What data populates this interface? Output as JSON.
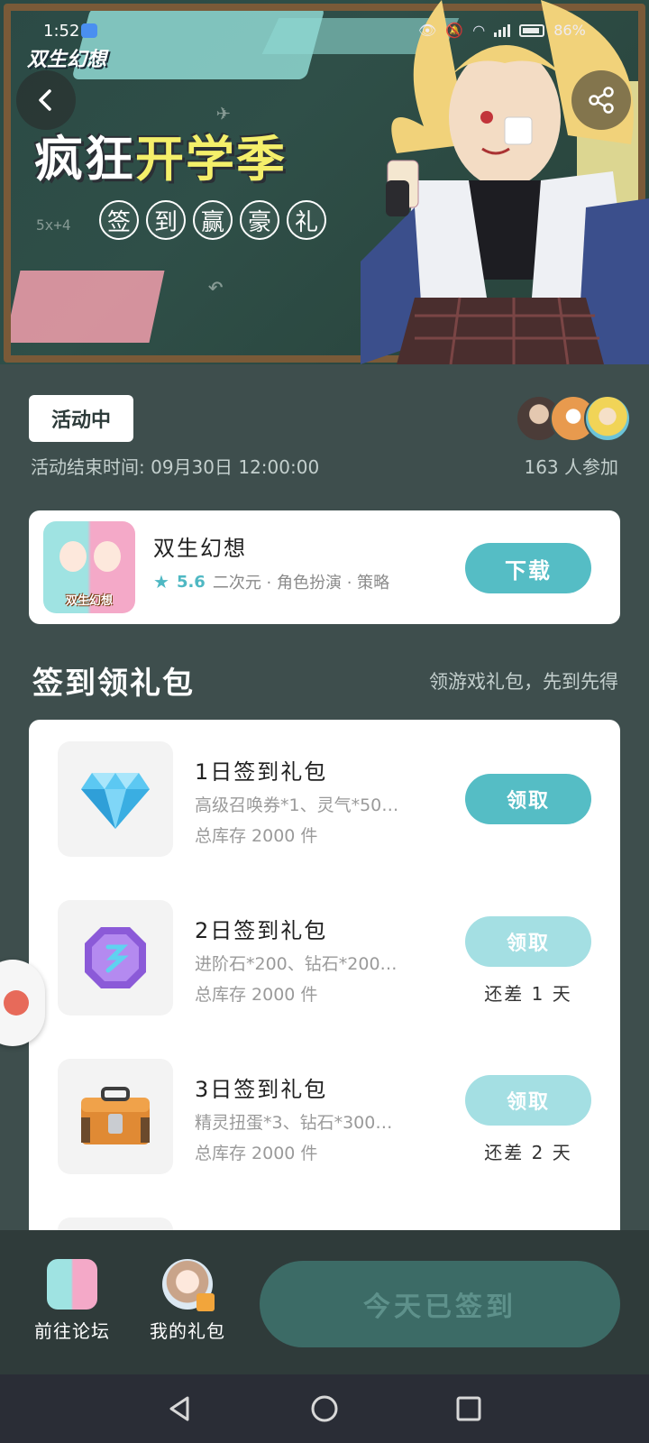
{
  "status_bar": {
    "time": "1:52",
    "battery": "86%"
  },
  "banner": {
    "game_logo": "双生幻想",
    "title_part1": "疯狂",
    "title_part2": "开学季",
    "subtitle_chars": [
      "签",
      "到",
      "赢",
      "豪",
      "礼"
    ]
  },
  "event": {
    "status": "活动中",
    "end_time": "活动结束时间: 09月30日 12:00:00",
    "participants": "163 人参加"
  },
  "app": {
    "name": "双生幻想",
    "rating": "5.6",
    "tags": "二次元 · 角色扮演 · 策略",
    "icon_label": "双生幻想",
    "download_label": "下载"
  },
  "section": {
    "title": "签到领礼包",
    "subtitle": "领游戏礼包，先到先得"
  },
  "gifts": [
    {
      "title": "1日签到礼包",
      "desc": "高级召唤券*1、灵气*50…",
      "stock": "总库存 2000 件",
      "button": "领取",
      "days_left": ""
    },
    {
      "title": "2日签到礼包",
      "desc": "进阶石*200、钻石*200…",
      "stock": "总库存 2000 件",
      "button": "领取",
      "days_left": "还差 1 天"
    },
    {
      "title": "3日签到礼包",
      "desc": "精灵扭蛋*3、钻石*300…",
      "stock": "总库存 2000 件",
      "button": "领取",
      "days_left": "还差 2 天"
    }
  ],
  "bottom_bar": {
    "forum_label": "前往论坛",
    "my_gifts_label": "我的礼包",
    "signed_label": "今天已签到"
  },
  "colors": {
    "background": "#3e4e4d",
    "accent": "#55bdc5",
    "accent_disabled": "#a4dfe3",
    "bottom_bar": "#2f3b3a"
  }
}
